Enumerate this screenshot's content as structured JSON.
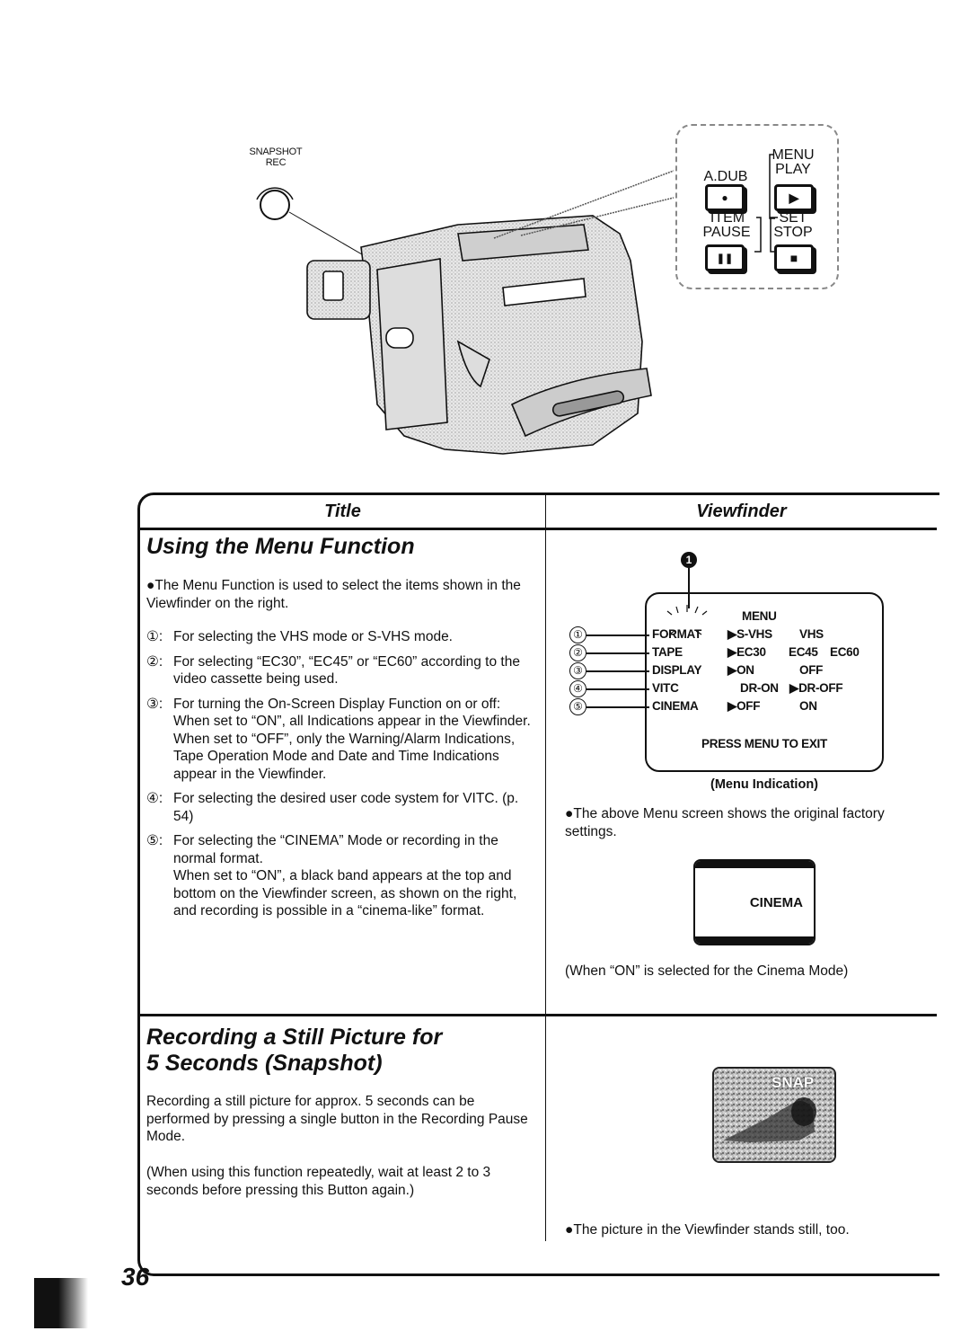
{
  "illustration": {
    "snapshot_label": [
      "SNAPSHOT",
      "REC"
    ],
    "buttons": [
      {
        "top_label": "A.DUB",
        "symbol": "●",
        "icon": "record-dub-icon"
      },
      {
        "top_label": [
          "MENU",
          "PLAY"
        ],
        "symbol": "▶",
        "icon": "play-icon"
      },
      {
        "top_label": [
          "ITEM",
          "PAUSE"
        ],
        "symbol": "❚❚",
        "icon": "pause-icon"
      },
      {
        "top_label": [
          "SET",
          "STOP"
        ],
        "symbol": "■",
        "icon": "stop-icon"
      }
    ],
    "button_labels": {
      "adub": "A.DUB",
      "menu": "MENU",
      "play": "PLAY",
      "item": "ITEM",
      "pause": "PAUSE",
      "set": "SET",
      "stop": "STOP"
    },
    "button_symbols": {
      "adub": "●",
      "play": "▶",
      "pause": "❚❚",
      "stop": "■"
    }
  },
  "table": {
    "col_title": "Title",
    "col_viewfinder": "Viewfinder",
    "section1": {
      "heading": "Using the Menu Function",
      "intro": "●The Menu Function is used to select the items shown in the Viewfinder on the right.",
      "items": [
        {
          "num": "①:",
          "lines": [
            "For selecting the VHS mode or S-VHS mode."
          ]
        },
        {
          "num": "②:",
          "lines": [
            "For selecting “EC30”, “EC45” or “EC60” according to the video cassette being used."
          ]
        },
        {
          "num": "③:",
          "lines": [
            "For turning the On-Screen Display Function on or off:",
            "When set to “ON”, all Indications appear in the Viewfinder.",
            "When set to “OFF”, only the Warning/Alarm Indications, Tape Operation Mode and Date and Time Indications appear in the Viewfinder."
          ]
        },
        {
          "num": "④:",
          "lines": [
            "For selecting the desired user code system for VITC. (p. 54)"
          ]
        },
        {
          "num": "⑤:",
          "lines": [
            "For selecting the “CINEMA” Mode or recording in the normal format.",
            "When set to “ON”, a black band appears at the top and bottom on the Viewfinder screen, as shown on the right, and recording is possible in a “cinema-like” format."
          ]
        }
      ],
      "viewfinder": {
        "marker": "1",
        "menu_title": "MENU",
        "rows": [
          {
            "num": "①",
            "name": "FORMAT",
            "opt1": "▶S-VHS",
            "opt2": "VHS",
            "opt3": ""
          },
          {
            "num": "②",
            "name": "TAPE",
            "opt1": "▶EC30",
            "opt2": "EC45",
            "opt3": "EC60"
          },
          {
            "num": "③",
            "name": "DISPLAY",
            "opt1": "▶ON",
            "opt2": "OFF",
            "opt3": ""
          },
          {
            "num": "④",
            "name": "VITC",
            "opt1": "DR-ON",
            "opt2": "▶DR-OFF",
            "opt3": ""
          },
          {
            "num": "⑤",
            "name": "CINEMA",
            "opt1": "▶OFF",
            "opt2": "ON",
            "opt3": ""
          }
        ],
        "footer": "PRESS MENU TO EXIT",
        "caption": "(Menu Indication)",
        "note": "●The above Menu screen shows the original factory settings.",
        "cinema_label": "CINEMA",
        "cinema_caption": "(When “ON” is selected for the Cinema Mode)"
      }
    },
    "section2": {
      "heading_lines": [
        "Recording a Still Picture for",
        "5 Seconds (Snapshot)"
      ],
      "para1": "Recording a still picture for approx. 5 seconds can be performed by pressing a single button in the Recording Pause Mode.",
      "para2": "(When using this function repeatedly, wait at least 2 to 3 seconds before pressing this Button again.)",
      "snap_overlay": "SNAP",
      "note": "●The picture in the Viewfinder stands still, too."
    }
  },
  "page_number": "36"
}
